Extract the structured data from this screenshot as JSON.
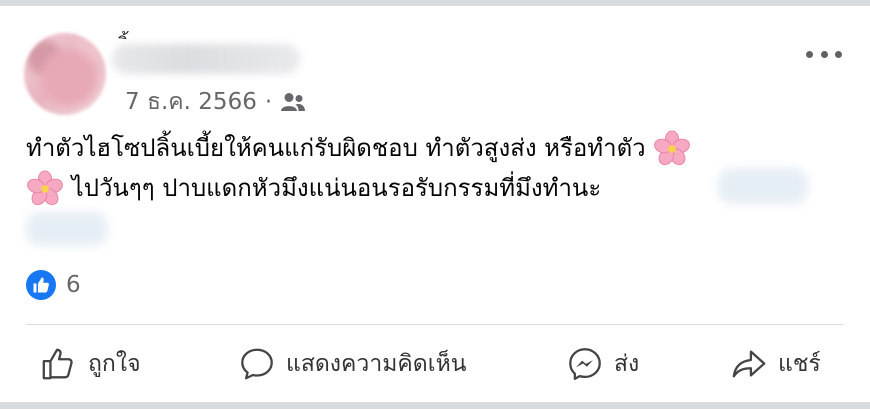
{
  "post": {
    "author_mark": "ิ้",
    "date": "7 ธ.ค. 2566",
    "separator": "·",
    "audience_icon": "friends-icon",
    "more_icon": "more-options-icon",
    "text_line1": "ทำตัวไฮโซปลิ้นเบี้ยให้คนแก่รับผิดชอบ ทำตัวสูงส่ง หรือทำตัว",
    "text_line2": "ไปวันๆๆ ปาบแดกหัวมึงแน่นอนรอรับกรรมที่มึงทำนะ",
    "emoji": "cherry-blossom"
  },
  "reactions": {
    "icon": "like-icon",
    "count": "6"
  },
  "actions": {
    "like_label": "ถูกใจ",
    "comment_label": "แสดงความคิดเห็น",
    "send_label": "ส่ง",
    "share_label": "แชร์"
  },
  "colors": {
    "like_blue": "#1877f2",
    "secondary_text": "#65676b"
  }
}
